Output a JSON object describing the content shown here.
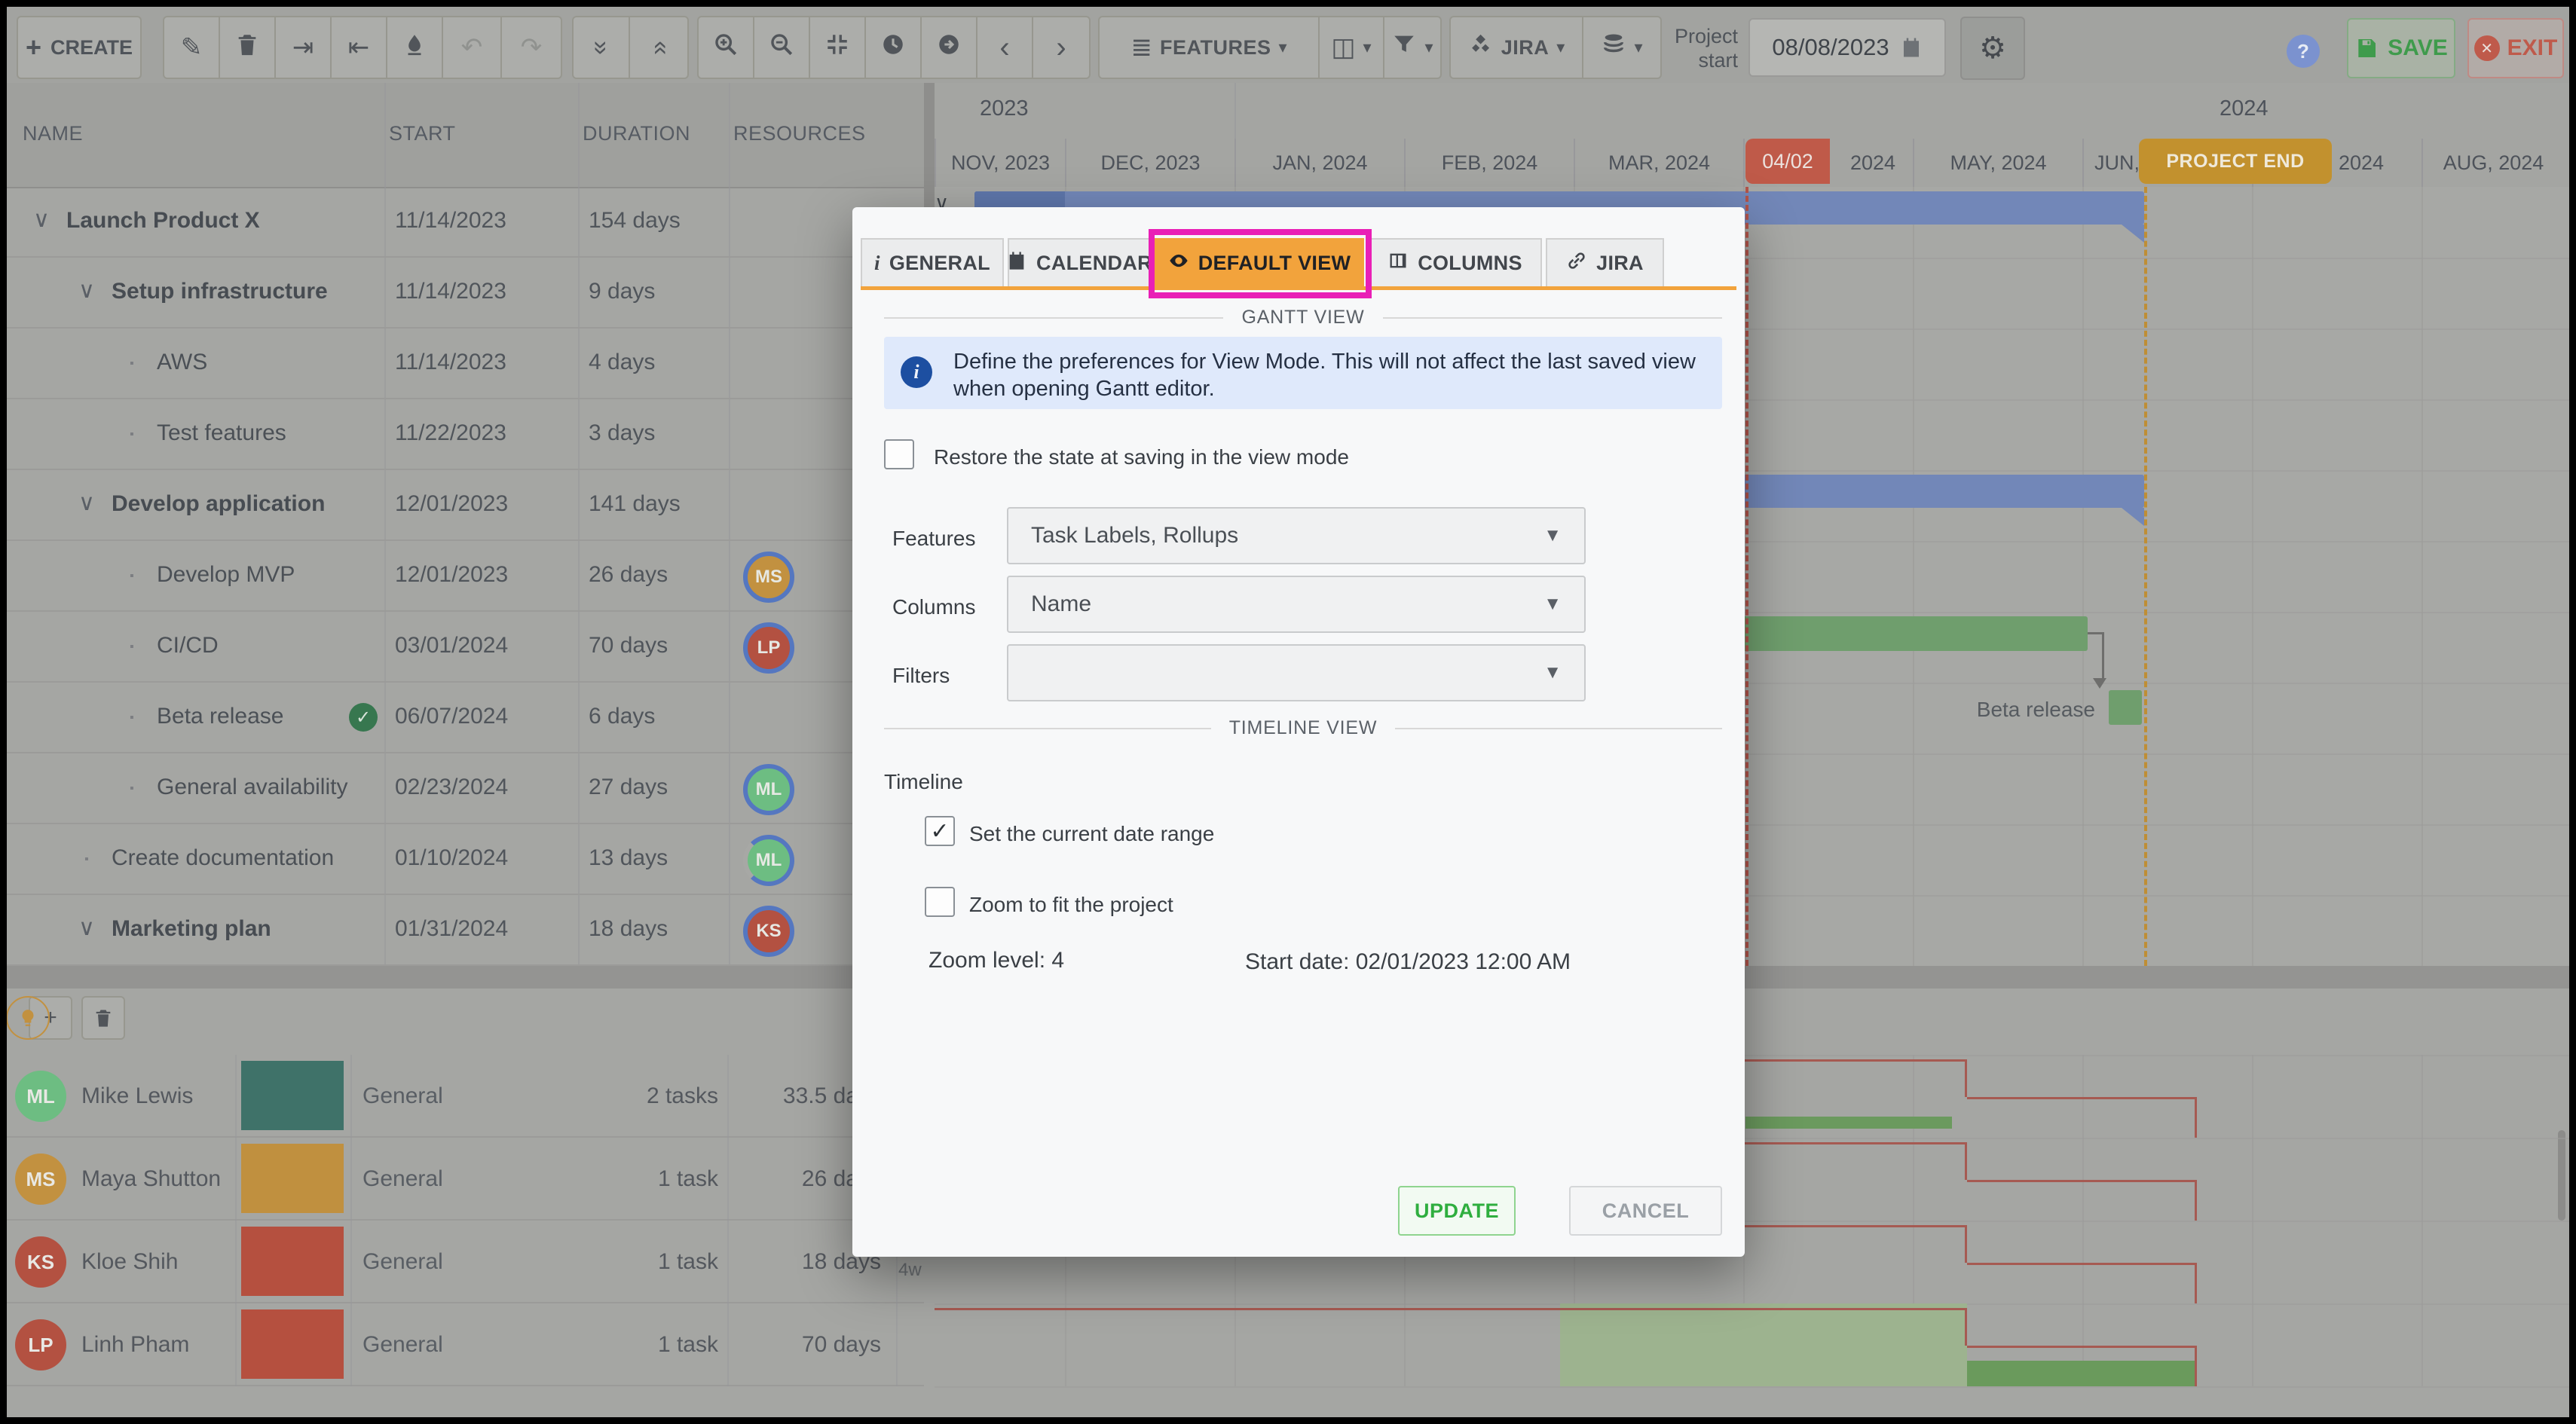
{
  "toolbar": {
    "create_label": "CREATE",
    "groups": [
      {
        "name": "edit-tools",
        "buttons": [
          {
            "name": "edit",
            "icon": "pencil-icon"
          },
          {
            "name": "delete",
            "icon": "trash-icon"
          },
          {
            "name": "indent",
            "icon": "indent-icon"
          },
          {
            "name": "outdent",
            "icon": "outdent-icon"
          },
          {
            "name": "clear",
            "icon": "eraser-icon"
          },
          {
            "name": "undo",
            "icon": "undo-icon",
            "disabled": true
          },
          {
            "name": "redo",
            "icon": "redo-icon",
            "disabled": true
          }
        ]
      },
      {
        "name": "expand-tools",
        "buttons": [
          {
            "name": "collapse-all",
            "icon": "collapse-icon"
          },
          {
            "name": "expand-all",
            "icon": "expand-icon"
          }
        ]
      },
      {
        "name": "view-tools",
        "buttons": [
          {
            "name": "zoom-in",
            "icon": "zoom-in-icon"
          },
          {
            "name": "zoom-out",
            "icon": "zoom-out-icon"
          },
          {
            "name": "zoom-fit",
            "icon": "fit-icon"
          },
          {
            "name": "time-marker",
            "icon": "clock-icon"
          },
          {
            "name": "go-to-date",
            "icon": "go-icon"
          },
          {
            "name": "scroll-prev",
            "icon": "chevron-left-icon"
          },
          {
            "name": "scroll-next",
            "icon": "chevron-right-icon"
          }
        ]
      },
      {
        "name": "feature-tools",
        "buttons": [
          {
            "name": "features",
            "icon": "list-icon",
            "label": "FEATURES",
            "caret": true
          },
          {
            "name": "columns",
            "icon": "grid-columns-icon",
            "caret": true
          },
          {
            "name": "filter",
            "icon": "filter-icon",
            "caret": true
          }
        ]
      },
      {
        "name": "jira-tools",
        "buttons": [
          {
            "name": "jira",
            "icon": "jira-icon",
            "label": "JIRA",
            "caret": true
          },
          {
            "name": "baseline",
            "icon": "layers-icon",
            "caret": true
          }
        ]
      }
    ],
    "project_start_label": "Project start",
    "project_start_date": "08/08/2023",
    "help_label": "?",
    "save_label": "SAVE",
    "exit_label": "EXIT"
  },
  "task_table": {
    "columns": [
      "NAME",
      "START",
      "DURATION",
      "RESOURCES"
    ],
    "rows": [
      {
        "name": "Launch Product X",
        "level": 0,
        "marker": "chevron",
        "bold": true,
        "start": "11/14/2023",
        "duration": "154 days"
      },
      {
        "name": "Setup infrastructure",
        "level": 1,
        "marker": "chevron",
        "bold": true,
        "start": "11/14/2023",
        "duration": "9 days"
      },
      {
        "name": "AWS",
        "level": 2,
        "marker": "bullet",
        "bold": false,
        "start": "11/14/2023",
        "duration": "4 days"
      },
      {
        "name": "Test features",
        "level": 2,
        "marker": "bullet",
        "bold": false,
        "start": "11/22/2023",
        "duration": "3 days"
      },
      {
        "name": "Develop application",
        "level": 1,
        "marker": "chevron",
        "bold": true,
        "start": "12/01/2023",
        "duration": "141 days"
      },
      {
        "name": "Develop MVP",
        "level": 2,
        "marker": "bullet",
        "bold": false,
        "start": "12/01/2023",
        "duration": "26 days",
        "avatar": {
          "initials": "MS",
          "color": "#c29140",
          "ring": "full"
        }
      },
      {
        "name": "CI/CD",
        "level": 2,
        "marker": "bullet",
        "bold": false,
        "start": "03/01/2024",
        "duration": "70 days",
        "avatar": {
          "initials": "LP",
          "color": "#b35141",
          "ring": "full"
        }
      },
      {
        "name": "Beta release",
        "level": 2,
        "marker": "bullet",
        "bold": false,
        "check": true,
        "start": "06/07/2024",
        "duration": "6 days"
      },
      {
        "name": "General availability",
        "level": 2,
        "marker": "bullet",
        "bold": false,
        "start": "02/23/2024",
        "duration": "27 days",
        "avatar": {
          "initials": "ML",
          "color": "#6dbd82",
          "ring": "full"
        }
      },
      {
        "name": "Create documentation",
        "level": 1,
        "marker": "bullet",
        "bold": false,
        "start": "01/10/2024",
        "duration": "13 days",
        "avatar": {
          "initials": "ML",
          "color": "#6dbd82",
          "ring": "partial"
        }
      },
      {
        "name": "Marketing plan",
        "level": 1,
        "marker": "chevron",
        "bold": true,
        "start": "01/31/2024",
        "duration": "18 days",
        "avatar": {
          "initials": "KS",
          "color": "#b35141",
          "ring": "full"
        }
      }
    ]
  },
  "timeline": {
    "years": [
      "2023",
      "2024"
    ],
    "months": [
      "NOV, 2023",
      "DEC, 2023",
      "JAN, 2024",
      "FEB, 2024",
      "MAR, 2024",
      "2024",
      "MAY, 2024",
      "JUN,",
      "JUL, 2024",
      "AUG, 2024"
    ],
    "date_badge": "04/02",
    "project_end_badge": "PROJECT END",
    "beta_bar_label": "Beta release",
    "scale_label": "4w"
  },
  "resource_panel": {
    "rows": [
      {
        "initials": "ML",
        "avatar_color": "#6dbd82",
        "name": "Mike Lewis",
        "swatch_color": "#3f7269",
        "type": "General",
        "tasks": "2 tasks",
        "duration": "33.5 days"
      },
      {
        "initials": "MS",
        "avatar_color": "#c29140",
        "name": "Maya Shutton",
        "swatch_color": "#c0903f",
        "type": "General",
        "tasks": "1 task",
        "duration": "26 days"
      },
      {
        "initials": "KS",
        "avatar_color": "#b35141",
        "name": "Kloe Shih",
        "swatch_color": "#b5503f",
        "type": "General",
        "tasks": "1 task",
        "duration": "18 days"
      },
      {
        "initials": "LP",
        "avatar_color": "#b35141",
        "name": "Linh Pham",
        "swatch_color": "#b5503f",
        "type": "General",
        "tasks": "1 task",
        "duration": "70 days"
      }
    ]
  },
  "modal": {
    "tabs": [
      {
        "label": "GENERAL",
        "icon": "info-icon",
        "active": false
      },
      {
        "label": "CALENDAR",
        "icon": "calendar-icon",
        "active": false
      },
      {
        "label": "DEFAULT VIEW",
        "icon": "eye-icon",
        "active": true
      },
      {
        "label": "COLUMNS",
        "icon": "table-columns-icon",
        "active": false
      },
      {
        "label": "JIRA",
        "icon": "link-icon",
        "active": false
      }
    ],
    "section_gantt": "GANTT VIEW",
    "info_text": "Define the preferences for View Mode. This will not affect the last saved view when opening Gantt editor.",
    "restore_label": "Restore the state at saving in the view mode",
    "fields": [
      {
        "label": "Features",
        "value": "Task Labels, Rollups"
      },
      {
        "label": "Columns",
        "value": "Name"
      },
      {
        "label": "Filters",
        "value": ""
      }
    ],
    "section_timeline": "TIMELINE VIEW",
    "timeline_label": "Timeline",
    "check_date_range": {
      "label": "Set the current date range",
      "checked": true
    },
    "check_zoom_fit": {
      "label": "Zoom to fit the project",
      "checked": false
    },
    "zoom_level": "Zoom level: 4",
    "start_date": "Start date: 02/01/2023 12:00 AM",
    "update_label": "UPDATE",
    "cancel_label": "CANCEL"
  },
  "colors": {
    "accent_orange": "#f2a33c",
    "highlight_magenta": "#e91fb6",
    "badge_red": "#bf5a49",
    "badge_orange": "#c2912e",
    "bar_blue": "#7287b8",
    "bar_green": "#6f9e6d",
    "fill_light_green": "#9db38f",
    "step_red": "#a65a52",
    "ring_blue": "#5577c0"
  }
}
